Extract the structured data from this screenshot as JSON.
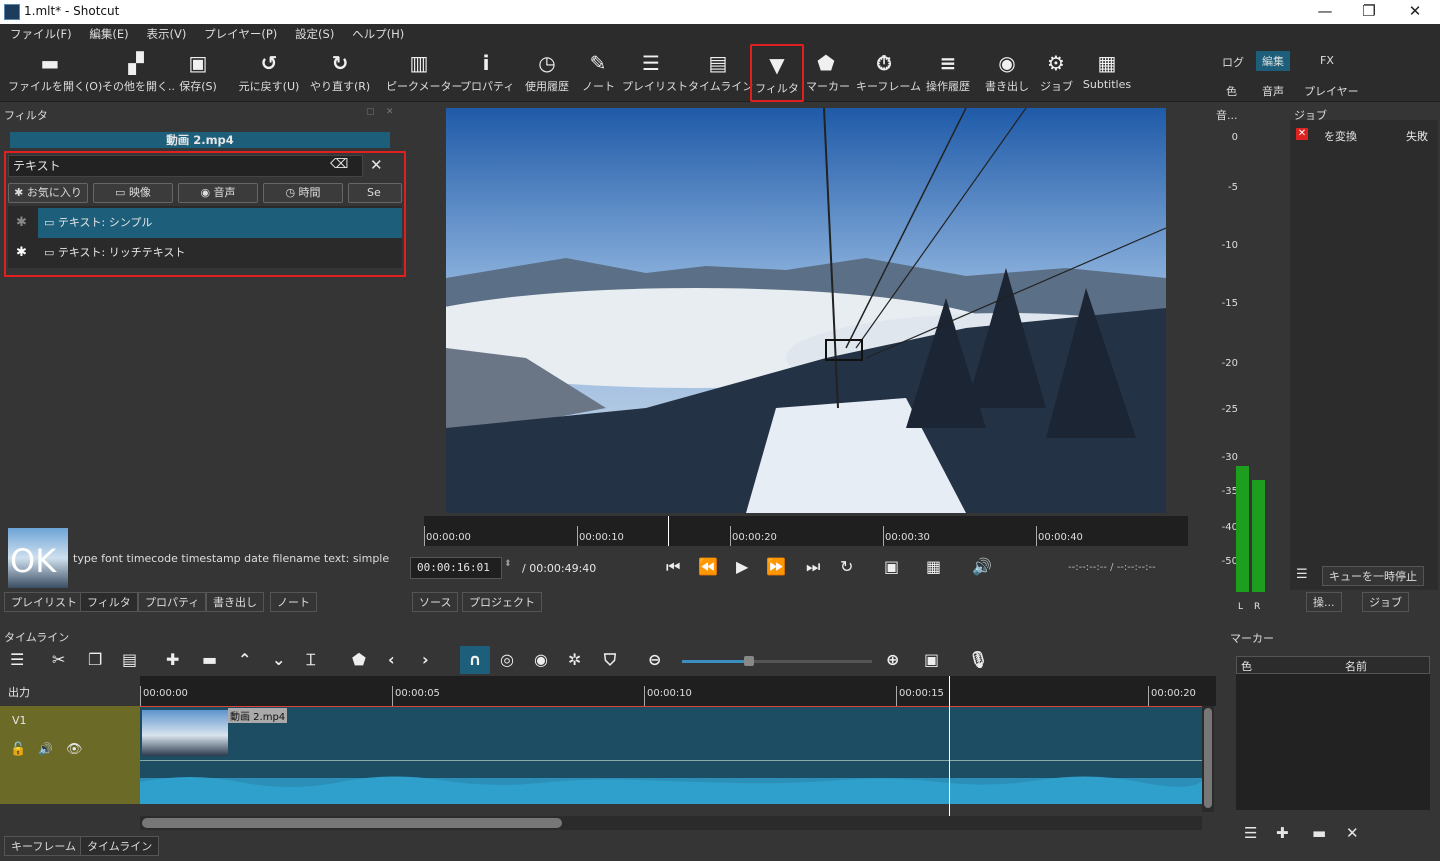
{
  "window": {
    "title": "1.mlt* - Shotcut",
    "min": "—",
    "max": "❐",
    "close": "✕"
  },
  "menu": [
    "ファイル(F)",
    "編集(E)",
    "表示(V)",
    "プレイヤー(P)",
    "設定(S)",
    "ヘルプ(H)"
  ],
  "toolbar": {
    "open": "ファイルを開く(O)",
    "open_other": "その他を開く..",
    "save": "保存(S)",
    "undo": "元に戻す(U)",
    "redo": "やり直す(R)",
    "peak": "ピークメーター",
    "properties": "プロパティ",
    "history": "使用履歴",
    "notes": "ノート",
    "playlist": "プレイリスト",
    "timeline": "タイムライン",
    "filter": "フィルタ",
    "marker": "マーカー",
    "keyframe": "キーフレーム",
    "ops_history": "操作履歴",
    "export": "書き出し",
    "jobs": "ジョブ",
    "subtitles": "Subtitles"
  },
  "layouts": {
    "log": "ログ",
    "edit": "編集",
    "fx": "FX",
    "color": "色",
    "audio": "音声",
    "player": "プレイヤー"
  },
  "filter_panel": {
    "title": "フィルタ",
    "clip": "動画 2.mp4",
    "search": "テキスト",
    "cats": [
      "お気に入り",
      "映像",
      "音声",
      "時間",
      "Se"
    ],
    "items": [
      "テキスト: シンプル",
      "テキスト: リッチテキスト"
    ],
    "desc": "type font timecode timestamp date filename text: simple",
    "thumb_text": "OK"
  },
  "left_tabs": [
    "プレイリスト",
    "フィルタ",
    "プロパティ",
    "書き出し",
    "ノート"
  ],
  "player": {
    "ruler": [
      "00:00:00",
      "00:00:10",
      "00:00:20",
      "00:00:30",
      "00:00:40"
    ],
    "timecode": "00:00:16:01",
    "duration": "/ 00:00:49:40",
    "inout": "--:--:--:--  /  --:--:--:--",
    "tabs": [
      "ソース",
      "プロジェクト"
    ]
  },
  "meter": {
    "title": "音...",
    "labels": [
      "0",
      "-5",
      "-10",
      "-15",
      "-20",
      "-25",
      "-30",
      "-35",
      "-40",
      "-50"
    ],
    "l": "L",
    "r": "R",
    "level_l": 0.27,
    "level_r": 0.24
  },
  "jobs": {
    "title": "ジョブ",
    "job": "を変換",
    "status": "失敗",
    "pause": "キューを一時停止",
    "ops": "操...",
    "jobs_btn": "ジョブ"
  },
  "timeline": {
    "title": "タイムライン",
    "output": "出力",
    "track": "V1",
    "clip": "動画 2.mp4",
    "ruler": [
      "00:00:00",
      "00:00:05",
      "00:00:10",
      "00:00:15",
      "00:00:20"
    ]
  },
  "marker": {
    "title": "マーカー",
    "col_color": "色",
    "col_name": "名前"
  },
  "bottom_tabs": [
    "キーフレーム",
    "タイムライン"
  ]
}
